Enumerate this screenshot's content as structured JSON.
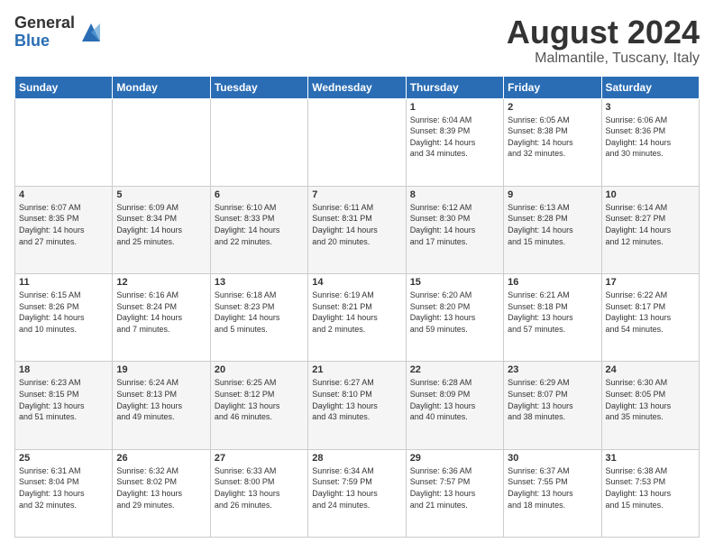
{
  "logo": {
    "general": "General",
    "blue": "Blue"
  },
  "title": "August 2024",
  "subtitle": "Malmantile, Tuscany, Italy",
  "days_header": [
    "Sunday",
    "Monday",
    "Tuesday",
    "Wednesday",
    "Thursday",
    "Friday",
    "Saturday"
  ],
  "weeks": [
    [
      {
        "day": "",
        "info": ""
      },
      {
        "day": "",
        "info": ""
      },
      {
        "day": "",
        "info": ""
      },
      {
        "day": "",
        "info": ""
      },
      {
        "day": "1",
        "info": "Sunrise: 6:04 AM\nSunset: 8:39 PM\nDaylight: 14 hours\nand 34 minutes."
      },
      {
        "day": "2",
        "info": "Sunrise: 6:05 AM\nSunset: 8:38 PM\nDaylight: 14 hours\nand 32 minutes."
      },
      {
        "day": "3",
        "info": "Sunrise: 6:06 AM\nSunset: 8:36 PM\nDaylight: 14 hours\nand 30 minutes."
      }
    ],
    [
      {
        "day": "4",
        "info": "Sunrise: 6:07 AM\nSunset: 8:35 PM\nDaylight: 14 hours\nand 27 minutes."
      },
      {
        "day": "5",
        "info": "Sunrise: 6:09 AM\nSunset: 8:34 PM\nDaylight: 14 hours\nand 25 minutes."
      },
      {
        "day": "6",
        "info": "Sunrise: 6:10 AM\nSunset: 8:33 PM\nDaylight: 14 hours\nand 22 minutes."
      },
      {
        "day": "7",
        "info": "Sunrise: 6:11 AM\nSunset: 8:31 PM\nDaylight: 14 hours\nand 20 minutes."
      },
      {
        "day": "8",
        "info": "Sunrise: 6:12 AM\nSunset: 8:30 PM\nDaylight: 14 hours\nand 17 minutes."
      },
      {
        "day": "9",
        "info": "Sunrise: 6:13 AM\nSunset: 8:28 PM\nDaylight: 14 hours\nand 15 minutes."
      },
      {
        "day": "10",
        "info": "Sunrise: 6:14 AM\nSunset: 8:27 PM\nDaylight: 14 hours\nand 12 minutes."
      }
    ],
    [
      {
        "day": "11",
        "info": "Sunrise: 6:15 AM\nSunset: 8:26 PM\nDaylight: 14 hours\nand 10 minutes."
      },
      {
        "day": "12",
        "info": "Sunrise: 6:16 AM\nSunset: 8:24 PM\nDaylight: 14 hours\nand 7 minutes."
      },
      {
        "day": "13",
        "info": "Sunrise: 6:18 AM\nSunset: 8:23 PM\nDaylight: 14 hours\nand 5 minutes."
      },
      {
        "day": "14",
        "info": "Sunrise: 6:19 AM\nSunset: 8:21 PM\nDaylight: 14 hours\nand 2 minutes."
      },
      {
        "day": "15",
        "info": "Sunrise: 6:20 AM\nSunset: 8:20 PM\nDaylight: 13 hours\nand 59 minutes."
      },
      {
        "day": "16",
        "info": "Sunrise: 6:21 AM\nSunset: 8:18 PM\nDaylight: 13 hours\nand 57 minutes."
      },
      {
        "day": "17",
        "info": "Sunrise: 6:22 AM\nSunset: 8:17 PM\nDaylight: 13 hours\nand 54 minutes."
      }
    ],
    [
      {
        "day": "18",
        "info": "Sunrise: 6:23 AM\nSunset: 8:15 PM\nDaylight: 13 hours\nand 51 minutes."
      },
      {
        "day": "19",
        "info": "Sunrise: 6:24 AM\nSunset: 8:13 PM\nDaylight: 13 hours\nand 49 minutes."
      },
      {
        "day": "20",
        "info": "Sunrise: 6:25 AM\nSunset: 8:12 PM\nDaylight: 13 hours\nand 46 minutes."
      },
      {
        "day": "21",
        "info": "Sunrise: 6:27 AM\nSunset: 8:10 PM\nDaylight: 13 hours\nand 43 minutes."
      },
      {
        "day": "22",
        "info": "Sunrise: 6:28 AM\nSunset: 8:09 PM\nDaylight: 13 hours\nand 40 minutes."
      },
      {
        "day": "23",
        "info": "Sunrise: 6:29 AM\nSunset: 8:07 PM\nDaylight: 13 hours\nand 38 minutes."
      },
      {
        "day": "24",
        "info": "Sunrise: 6:30 AM\nSunset: 8:05 PM\nDaylight: 13 hours\nand 35 minutes."
      }
    ],
    [
      {
        "day": "25",
        "info": "Sunrise: 6:31 AM\nSunset: 8:04 PM\nDaylight: 13 hours\nand 32 minutes."
      },
      {
        "day": "26",
        "info": "Sunrise: 6:32 AM\nSunset: 8:02 PM\nDaylight: 13 hours\nand 29 minutes."
      },
      {
        "day": "27",
        "info": "Sunrise: 6:33 AM\nSunset: 8:00 PM\nDaylight: 13 hours\nand 26 minutes."
      },
      {
        "day": "28",
        "info": "Sunrise: 6:34 AM\nSunset: 7:59 PM\nDaylight: 13 hours\nand 24 minutes."
      },
      {
        "day": "29",
        "info": "Sunrise: 6:36 AM\nSunset: 7:57 PM\nDaylight: 13 hours\nand 21 minutes."
      },
      {
        "day": "30",
        "info": "Sunrise: 6:37 AM\nSunset: 7:55 PM\nDaylight: 13 hours\nand 18 minutes."
      },
      {
        "day": "31",
        "info": "Sunrise: 6:38 AM\nSunset: 7:53 PM\nDaylight: 13 hours\nand 15 minutes."
      }
    ]
  ]
}
